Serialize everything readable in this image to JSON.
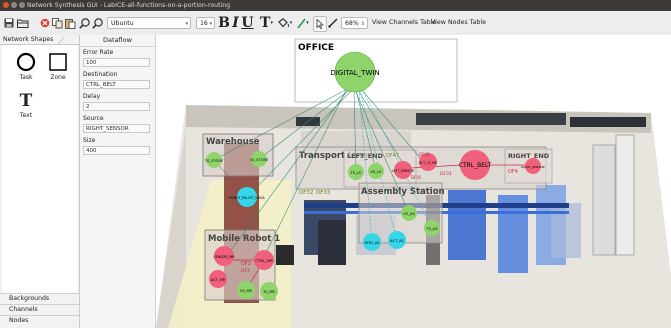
{
  "window": {
    "title": "Network Synthesis GUI - LabICE-all-functions-on-a-portion-routing"
  },
  "toolbar": {
    "font_family": "Ubuntu",
    "font_size": "16",
    "bold_label": "B",
    "italic_label": "I",
    "underline_label": "U",
    "text_label": "T",
    "zoom": "68%",
    "view_channels": "View Channels Table",
    "view_nodes": "View Nodes Table"
  },
  "sidebar": {
    "tab_label": "Network Shapes",
    "shapes": [
      {
        "label": "Task"
      },
      {
        "label": "Zone"
      },
      {
        "label": "Text"
      }
    ],
    "text_glyph": "T",
    "accordion": [
      "Backgrounds",
      "Channels",
      "Nodes"
    ]
  },
  "properties": {
    "header": "Dataflow",
    "fields": [
      {
        "label": "Error Rate",
        "value": "100"
      },
      {
        "label": "Destination",
        "value": "CTRL_BELT"
      },
      {
        "label": "Delay",
        "value": "2"
      },
      {
        "label": "Source",
        "value": "RIGHT_SENSOR"
      },
      {
        "label": "Size",
        "value": "400"
      }
    ]
  },
  "diagram": {
    "zones": {
      "office": "OFFICE",
      "warehouse": "Warehouse",
      "transport": "Transport Line",
      "left_end": "LEFT_END",
      "right_end": "RIGHT_END",
      "assembly": "Assembly Station",
      "mobile": "Mobile Robot 1"
    },
    "nodes": {
      "digital_twin": "DIGITAL_TWIN",
      "ts_store": "TS_STORE",
      "vs_store": "VS_STORE",
      "robot_pallet": "ROBOT_PALLET_MAGA",
      "ts_le": "TS_LE",
      "vs_le": "VS_LE",
      "left_sensor": "LEFT_SENSOR",
      "act_le": "ACT_LE_ME",
      "ctrl_belt": "CTRL_BELT",
      "right_sensor": "RIGHT_SENSOR",
      "vs_as": "VS_AS",
      "ts_as": "TS_AS",
      "rfid_as": "RFID_AS",
      "act_as": "ACT_AS",
      "sensor_mr": "SENSOR_MR",
      "ctrl_mr": "CTRL_MR",
      "act_mr": "ACT_MR",
      "vs_mr": "VS_MR",
      "ts_mr": "TS_MR"
    },
    "flow_labels": {
      "df32": "DF32",
      "df33": "DF33",
      "df47": "DF47",
      "df4": "DF4",
      "df31": "DF31",
      "df46": "DF46",
      "df2": "DF2",
      "df3": "DF3",
      "df45": "DF45"
    }
  },
  "colors": {
    "node_green": "#8fd46b",
    "node_red": "#f0607a",
    "node_cyan": "#35d6ea",
    "accent_blue": "#3a6fd8"
  }
}
